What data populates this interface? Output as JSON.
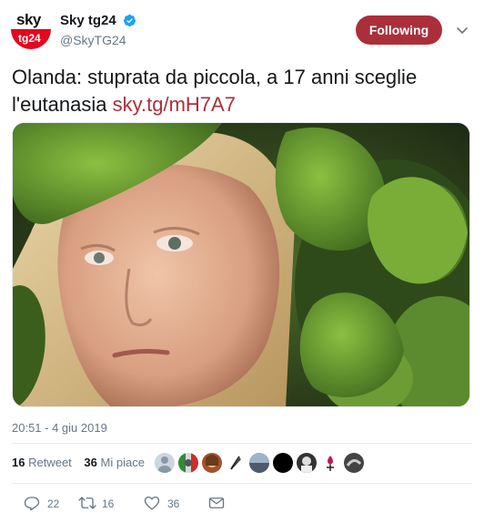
{
  "account": {
    "logo_top": "sky",
    "logo_bottom": "tg24",
    "display_name": "Sky tg24",
    "handle": "@SkyTG24",
    "follow_label": "Following"
  },
  "tweet": {
    "text": "Olanda: stuprata da piccola, a 17 anni sceglie l'eutanasia ",
    "link": "sky.tg/mH7A7",
    "timestamp": "20:51 - 4 giu 2019"
  },
  "stats": {
    "retweets_count": "16",
    "retweets_label": "Retweet",
    "likes_count": "36",
    "likes_label": "Mi piace"
  },
  "actions": {
    "reply_count": "22",
    "retweet_count": "16",
    "like_count": "36"
  },
  "colors": {
    "accent": "#ab2f3b",
    "brand_red": "#e1081f",
    "muted": "#657786",
    "verified": "#1da1f2"
  },
  "icons": [
    "verified-badge-icon",
    "chevron-down-icon",
    "reply-icon",
    "retweet-icon",
    "like-icon",
    "message-icon"
  ]
}
